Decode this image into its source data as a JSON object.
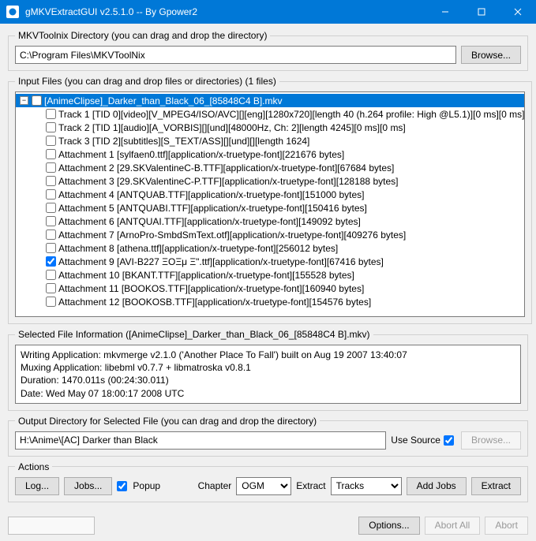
{
  "window": {
    "title": "gMKVExtractGUI v2.5.1.0 -- By Gpower2"
  },
  "mkvDir": {
    "legend": "MKVToolnix Directory (you can drag and drop the directory)",
    "path": "C:\\Program Files\\MKVToolNix",
    "browse": "Browse..."
  },
  "inputFiles": {
    "legend": "Input Files (you can drag and drop files or directories) (1 files)",
    "rootName": "[AnimeClipse]_Darker_than_Black_06_[85848C4 B].mkv",
    "items": [
      {
        "label": "Track 1 [TID 0][video][V_MPEG4/ISO/AVC][][eng][1280x720][length 40 (h.264 profile: High @L5.1)][0 ms][0 ms]",
        "checked": false
      },
      {
        "label": "Track 2 [TID 1][audio][A_VORBIS][][und][48000Hz, Ch: 2][length 4245][0 ms][0 ms]",
        "checked": false
      },
      {
        "label": "Track 3 [TID 2][subtitles][S_TEXT/ASS][][und][][length 1624]",
        "checked": false
      },
      {
        "label": "Attachment 1 [sylfaen0.ttf][application/x-truetype-font][221676 bytes]",
        "checked": false
      },
      {
        "label": "Attachment 2 [29.SKValentineC-B.TTF][application/x-truetype-font][67684 bytes]",
        "checked": false
      },
      {
        "label": "Attachment 3 [29.SKValentineC-P.TTF][application/x-truetype-font][128188 bytes]",
        "checked": false
      },
      {
        "label": "Attachment 4 [ANTQUAB.TTF][application/x-truetype-font][151000 bytes]",
        "checked": false
      },
      {
        "label": "Attachment 5 [ANTQUABI.TTF][application/x-truetype-font][150416 bytes]",
        "checked": false
      },
      {
        "label": "Attachment 6 [ANTQUAI.TTF][application/x-truetype-font][149092 bytes]",
        "checked": false
      },
      {
        "label": "Attachment 7 [ArnoPro-SmbdSmText.otf][application/x-truetype-font][409276 bytes]",
        "checked": false
      },
      {
        "label": "Attachment 8 [athena.ttf][application/x-truetype-font][256012 bytes]",
        "checked": false
      },
      {
        "label": "Attachment 9 [AVI-B227 ΞΟΞμ Ξ\".ttf][application/x-truetype-font][67416 bytes]",
        "checked": true
      },
      {
        "label": "Attachment 10 [BKANT.TTF][application/x-truetype-font][155528 bytes]",
        "checked": false
      },
      {
        "label": "Attachment 11 [BOOKOS.TTF][application/x-truetype-font][160940 bytes]",
        "checked": false
      },
      {
        "label": "Attachment 12 [BOOKOSB.TTF][application/x-truetype-font][154576 bytes]",
        "checked": false
      }
    ]
  },
  "fileInfo": {
    "legend": "Selected File Information ([AnimeClipse]_Darker_than_Black_06_[85848C4 B].mkv)",
    "lines": {
      "l1": "Writing Application: mkvmerge v2.1.0 ('Another Place To Fall') built on Aug 19 2007 13:40:07",
      "l2": "Muxing Application: libebml v0.7.7 + libmatroska v0.8.1",
      "l3": "Duration: 1470.011s (00:24:30.011)",
      "l4": "Date: Wed May 07 18:00:17 2008 UTC"
    }
  },
  "output": {
    "legend": "Output Directory for Selected File (you can drag and drop the directory)",
    "path": "H:\\Anime\\[AC] Darker than Black",
    "useSourceLabel": "Use Source",
    "browse": "Browse..."
  },
  "actions": {
    "legend": "Actions",
    "log": "Log...",
    "jobs": "Jobs...",
    "popup": "Popup",
    "chapterLabel": "Chapter",
    "chapterValue": "OGM",
    "extractLabel": "Extract",
    "extractValue": "Tracks",
    "addJobs": "Add Jobs",
    "extract": "Extract"
  },
  "bottom": {
    "options": "Options...",
    "abortAll": "Abort All",
    "abort": "Abort"
  }
}
